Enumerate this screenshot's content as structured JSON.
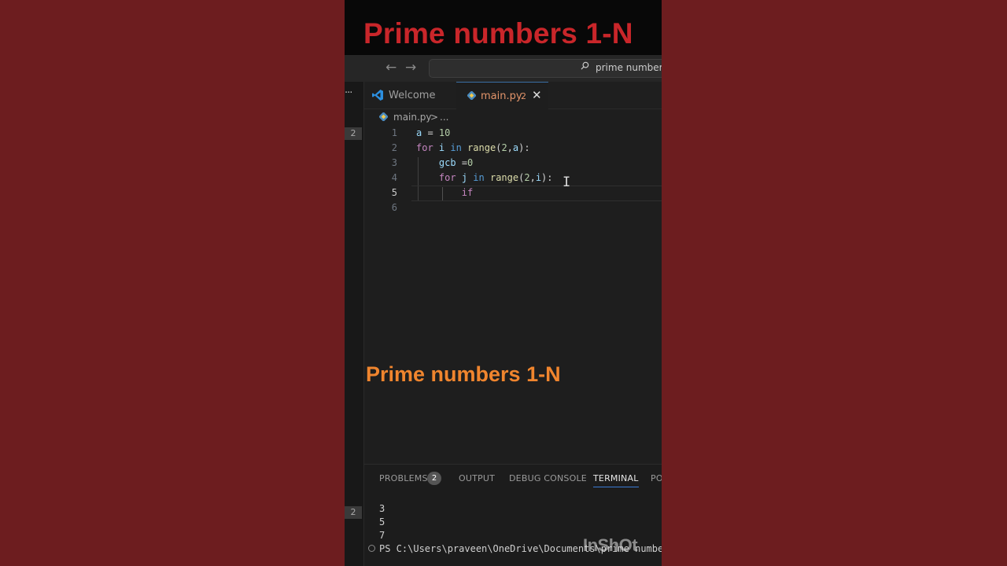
{
  "video": {
    "title": "Prime numbers 1-N",
    "caption": "Prime numbers 1-N",
    "watermark": "InShOt"
  },
  "command_bar": {
    "back_icon": "arrow-left-icon",
    "forward_icon": "arrow-right-icon",
    "search_text": "prime number"
  },
  "activity_bar": {
    "more": "···",
    "badge_top": "2",
    "badge_bottom": "2"
  },
  "tabs": [
    {
      "label": "Welcome",
      "icon": "vscode-icon"
    },
    {
      "label": "main.py",
      "count": "2",
      "icon": "python-file-icon",
      "close": "✕"
    }
  ],
  "breadcrumb": {
    "file": "main.py",
    "separator": ">",
    "ellipsis": "..."
  },
  "editor": {
    "line_numbers": [
      "1",
      "2",
      "3",
      "4",
      "5",
      "6"
    ],
    "active_line": "5"
  },
  "panel": {
    "tabs": {
      "problems": "PROBLEMS",
      "problems_count": "2",
      "output": "OUTPUT",
      "debug": "DEBUG CONSOLE",
      "terminal": "TERMINAL",
      "more": "PO"
    },
    "terminal_lines": [
      "3",
      "5",
      "7"
    ],
    "prompt": "PS C:\\Users\\praveen\\OneDrive\\Documents\\prime numbe"
  },
  "colors": {
    "background": "#6d1d1f",
    "title_red": "#c9262a",
    "caption_orange": "#f0852e",
    "editor_bg": "#1e1e1e",
    "tab_active_label": "#e2946a"
  }
}
